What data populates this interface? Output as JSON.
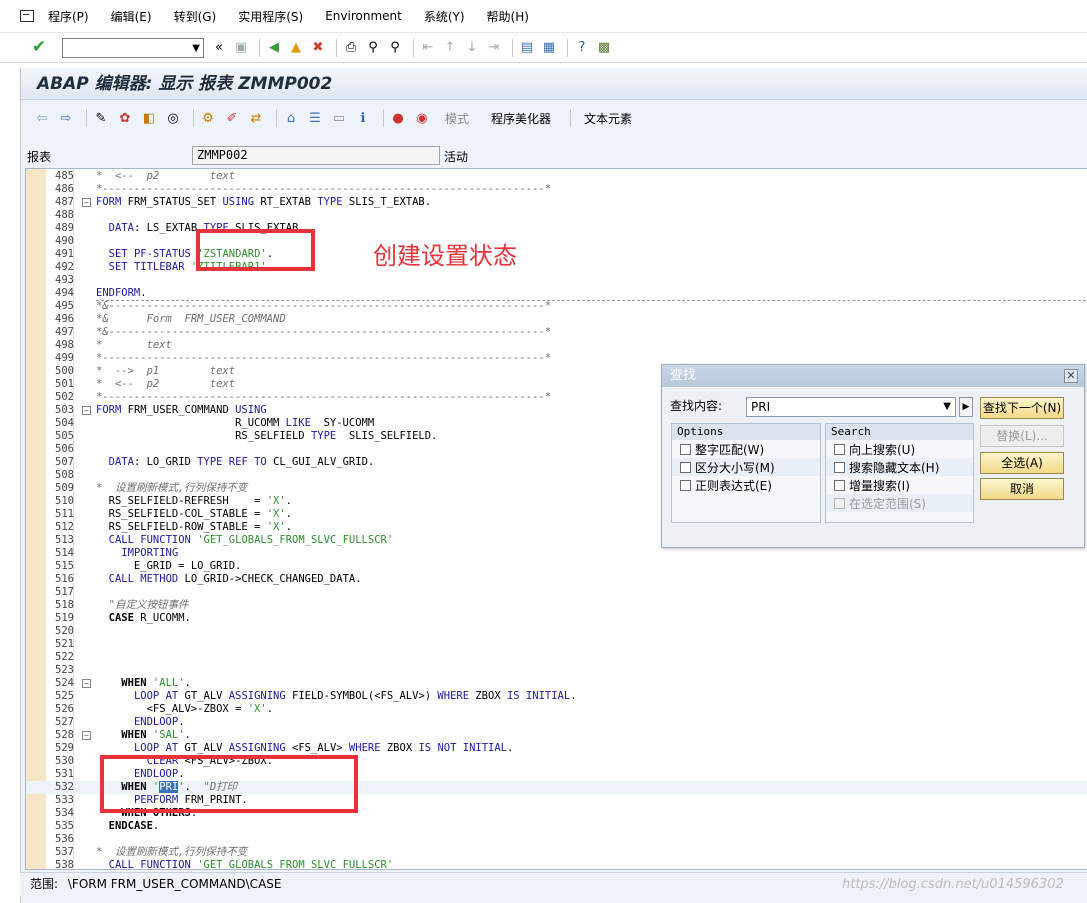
{
  "menubar": {
    "items": [
      "程序(P)",
      "编辑(E)",
      "转到(G)",
      "实用程序(S)",
      "Environment",
      "系统(Y)",
      "帮助(H)"
    ]
  },
  "window_title": "ABAP 编辑器: 显示 报表 ZMMP002",
  "app_toolbar": {
    "mode_label": "模式",
    "pretty_printer_label": "程序美化器",
    "text_elements_label": "文本元素"
  },
  "header": {
    "field_label": "报表",
    "report_name": "ZMMP002",
    "status": "活动"
  },
  "code_lines": [
    {
      "n": "485",
      "t": "*  <--  p2        text"
    },
    {
      "n": "486",
      "t": "*----------------------------------------------------------------------*"
    },
    {
      "n": "487",
      "t": "FORM FRM_STATUS_SET USING RT_EXTAB TYPE SLIS_T_EXTAB."
    },
    {
      "n": "488",
      "t": ""
    },
    {
      "n": "489",
      "t": "  DATA: LS_EXTAB TYPE SLIS_EXTAB."
    },
    {
      "n": "490",
      "t": ""
    },
    {
      "n": "491",
      "t": "  SET PF-STATUS 'ZSTANDARD'."
    },
    {
      "n": "492",
      "t": "  SET TITLEBAR 'ZTITLEBAR1'."
    },
    {
      "n": "493",
      "t": ""
    },
    {
      "n": "494",
      "t": "ENDFORM."
    },
    {
      "n": "495",
      "t": "*&---------------------------------------------------------------------*"
    },
    {
      "n": "496",
      "t": "*&      Form  FRM_USER_COMMAND"
    },
    {
      "n": "497",
      "t": "*&---------------------------------------------------------------------*"
    },
    {
      "n": "498",
      "t": "*       text"
    },
    {
      "n": "499",
      "t": "*----------------------------------------------------------------------*"
    },
    {
      "n": "500",
      "t": "*  -->  p1        text"
    },
    {
      "n": "501",
      "t": "*  <--  p2        text"
    },
    {
      "n": "502",
      "t": "*----------------------------------------------------------------------*"
    },
    {
      "n": "503",
      "t": "FORM FRM_USER_COMMAND USING"
    },
    {
      "n": "504",
      "t": "                      R_UCOMM LIKE  SY-UCOMM"
    },
    {
      "n": "505",
      "t": "                      RS_SELFIELD TYPE  SLIS_SELFIELD."
    },
    {
      "n": "506",
      "t": ""
    },
    {
      "n": "507",
      "t": "  DATA: LO_GRID TYPE REF TO CL_GUI_ALV_GRID."
    },
    {
      "n": "508",
      "t": ""
    },
    {
      "n": "509",
      "t": "*  设置刷新模式,行列保持不变"
    },
    {
      "n": "510",
      "t": "  RS_SELFIELD-REFRESH    = 'X'."
    },
    {
      "n": "511",
      "t": "  RS_SELFIELD-COL_STABLE = 'X'."
    },
    {
      "n": "512",
      "t": "  RS_SELFIELD-ROW_STABLE = 'X'."
    },
    {
      "n": "513",
      "t": "  CALL FUNCTION 'GET_GLOBALS_FROM_SLVC_FULLSCR'"
    },
    {
      "n": "514",
      "t": "    IMPORTING"
    },
    {
      "n": "515",
      "t": "      E_GRID = LO_GRID."
    },
    {
      "n": "516",
      "t": "  CALL METHOD LO_GRID->CHECK_CHANGED_DATA."
    },
    {
      "n": "517",
      "t": ""
    },
    {
      "n": "518",
      "t": "  \"自定义按钮事件"
    },
    {
      "n": "519",
      "t": "  CASE R_UCOMM."
    },
    {
      "n": "520",
      "t": ""
    },
    {
      "n": "521",
      "t": ""
    },
    {
      "n": "522",
      "t": ""
    },
    {
      "n": "523",
      "t": ""
    },
    {
      "n": "524",
      "t": "    WHEN 'ALL'."
    },
    {
      "n": "525",
      "t": "      LOOP AT GT_ALV ASSIGNING FIELD-SYMBOL(<FS_ALV>) WHERE ZBOX IS INITIAL."
    },
    {
      "n": "526",
      "t": "        <FS_ALV>-ZBOX = 'X'."
    },
    {
      "n": "527",
      "t": "      ENDLOOP."
    },
    {
      "n": "528",
      "t": "    WHEN 'SAL'."
    },
    {
      "n": "529",
      "t": "      LOOP AT GT_ALV ASSIGNING <FS_ALV> WHERE ZBOX IS NOT INITIAL."
    },
    {
      "n": "530",
      "t": "        CLEAR <FS_ALV>-ZBOX."
    },
    {
      "n": "531",
      "t": "      ENDLOOP."
    },
    {
      "n": "532",
      "t": "    WHEN 'PRI'.  \"D打印"
    },
    {
      "n": "533",
      "t": "      PERFORM FRM_PRINT."
    },
    {
      "n": "534",
      "t": "    WHEN OTHERS."
    },
    {
      "n": "535",
      "t": "  ENDCASE."
    },
    {
      "n": "536",
      "t": ""
    },
    {
      "n": "537",
      "t": "*  设置刷新模式,行列保持不变"
    },
    {
      "n": "538",
      "t": "  CALL FUNCTION 'GET_GLOBALS_FROM_SLVC_FULLSCR'"
    }
  ],
  "annotation": "创建设置状态",
  "find_dialog": {
    "title": "查找",
    "search_label": "查找内容:",
    "search_value": "PRI",
    "options_header": "Options",
    "options": [
      "整字匹配(W)",
      "区分大小写(M)",
      "正则表达式(E)"
    ],
    "search_header": "Search",
    "search_options": [
      "向上搜索(U)",
      "搜索隐藏文本(H)",
      "增量搜索(I)",
      "在选定范围(S)"
    ],
    "buttons": {
      "find_next": "查找下一个(N)",
      "replace": "替换(L)...",
      "select_all": "全选(A)",
      "cancel": "取消"
    }
  },
  "status_bar": {
    "scope_label": "范围:",
    "scope_value": "\\FORM FRM_USER_COMMAND\\CASE"
  },
  "watermark": "https://blog.csdn.net/u014596302",
  "colors": {
    "keyword": "#1a1aa6",
    "string": "#2f8f2f",
    "comment": "#6e6e6e",
    "annotation_red": "#e8323c"
  }
}
